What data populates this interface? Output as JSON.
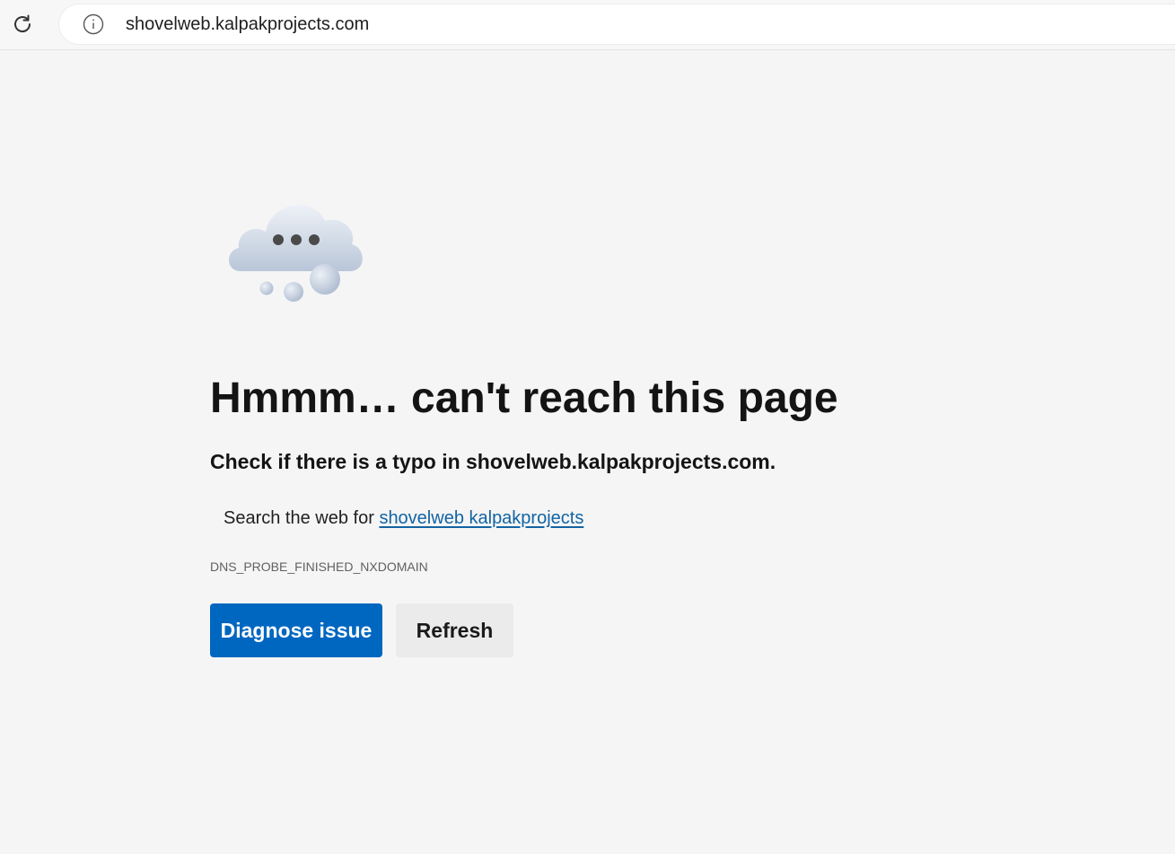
{
  "toolbar": {
    "reload_icon": "reload-icon",
    "info_icon": "info-icon",
    "url": "shovelweb.kalpakprojects.com"
  },
  "error_page": {
    "illustration": "cloud-thinking-icon",
    "title": "Hmmm… can't reach this page",
    "message": "Check if there is a typo in shovelweb.kalpakprojects.com.",
    "search_prefix": "Search the web for",
    "search_link": "shovelweb kalpakprojects",
    "error_code": "DNS_PROBE_FINISHED_NXDOMAIN",
    "diagnose_label": "Diagnose issue",
    "refresh_label": "Refresh"
  },
  "colors": {
    "page_background": "#f5f5f5",
    "primary_button": "#0067c0",
    "link": "#1264a3"
  }
}
